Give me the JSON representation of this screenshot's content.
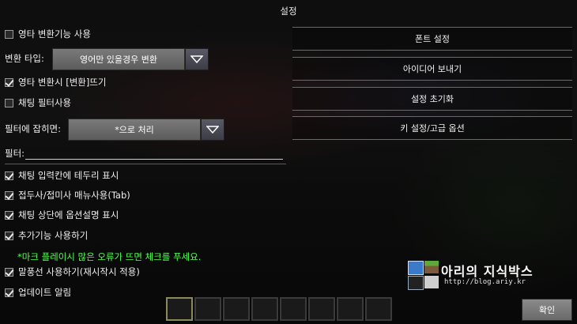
{
  "window": {
    "title": "설정"
  },
  "left": {
    "english_convert": {
      "label": "영타 변환기능 사용",
      "checked": false
    },
    "convert_type": {
      "label": "변환 타입:",
      "value": "영어만 있을경우 변환"
    },
    "convert_popup": {
      "label": "영타 변환시 [변환]뜨기",
      "checked": true
    },
    "chat_filter": {
      "label": "채팅 필터사용",
      "checked": false
    },
    "filter_action": {
      "label": "필터에 잡히면:",
      "value": "*으로 처리"
    },
    "filter_field": {
      "label": "필터:",
      "value": ""
    },
    "options": [
      {
        "label": "채팅 입력칸에 테두리 표시",
        "checked": true
      },
      {
        "label": "접두사/접미사 매뉴사용(Tab)",
        "checked": true
      },
      {
        "label": "채팅 상단에 옵션설명 표시",
        "checked": true
      },
      {
        "label": "추가기능 사용하기",
        "checked": true
      }
    ],
    "warning": "*마크 플레이시 많은 오류가 뜨면 체크를 푸세요.",
    "options2": [
      {
        "label": "말풍선 사용하기(재시작시 적용)",
        "checked": true
      },
      {
        "label": "업데이트 알림",
        "checked": true
      }
    ]
  },
  "right": {
    "buttons": [
      "폰트 설정",
      "아이디어 보내기",
      "설정 초기화",
      "키 설정/고급 옵션"
    ]
  },
  "confirm_label": "확인",
  "watermark": {
    "title": "아리의 지식박스",
    "url": "http://blog.ariy.kr"
  },
  "colors": {
    "warning": "#55ff55",
    "text": "#f0f0f0"
  }
}
